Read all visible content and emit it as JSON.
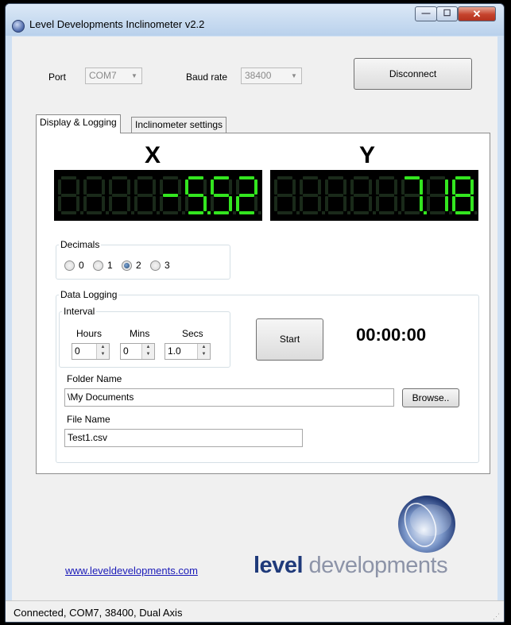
{
  "window": {
    "title": "Level Developments Inclinometer v2.2",
    "min_glyph": "—",
    "max_glyph": "☐",
    "close_glyph": "✕"
  },
  "connection": {
    "port_label": "Port",
    "port_value": "COM7",
    "baud_label": "Baud rate",
    "baud_value": "38400",
    "disconnect_label": "Disconnect"
  },
  "tabs": [
    {
      "label": "Display & Logging",
      "active": true
    },
    {
      "label": "Inclinometer settings",
      "active": false
    }
  ],
  "display": {
    "x_label": "X",
    "y_label": "Y",
    "x_value": "-5.52",
    "y_value": "7.18",
    "digit_on_color": "#33e61f",
    "digit_off_color": "#1a2a1a"
  },
  "decimals": {
    "title": "Decimals",
    "options": [
      "0",
      "1",
      "2",
      "3"
    ],
    "selected": "2"
  },
  "logging": {
    "title": "Data Logging",
    "interval_title": "Interval",
    "hours_label": "Hours",
    "hours_value": "0",
    "mins_label": "Mins",
    "mins_value": "0",
    "secs_label": "Secs",
    "secs_value": "1.0",
    "start_label": "Start",
    "timer": "00:00:00",
    "folder_label": "Folder Name",
    "folder_value": "\\My Documents",
    "browse_label": "Browse..",
    "file_label": "File Name",
    "file_value": "Test1.csv"
  },
  "footer": {
    "website": "www.leveldevelopments.com",
    "logo_word1": "level",
    "logo_word2": " developments",
    "status": "Connected, COM7, 38400, Dual Axis"
  }
}
